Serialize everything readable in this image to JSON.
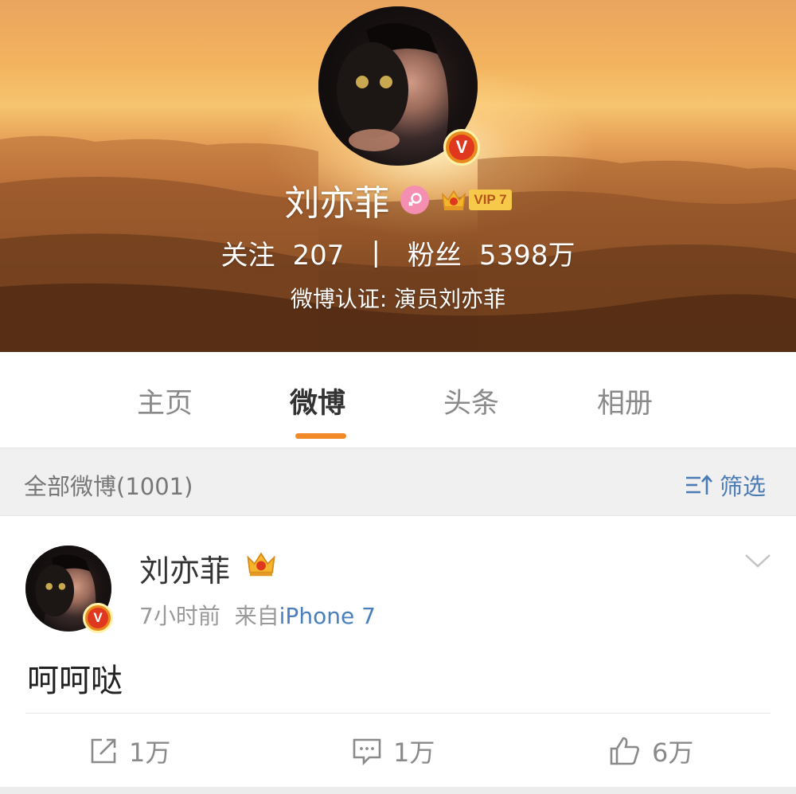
{
  "profile": {
    "name": "刘亦菲",
    "vip_label": "VIP 7",
    "stats": {
      "following_label": "关注",
      "following_value": "207",
      "separator": "|",
      "followers_label": "粉丝",
      "followers_value": "5398万"
    },
    "verification": "微博认证: 演员刘亦菲",
    "verified_badge": "V"
  },
  "tabs": [
    {
      "label": "主页",
      "active": false
    },
    {
      "label": "微博",
      "active": true
    },
    {
      "label": "头条",
      "active": false
    },
    {
      "label": "相册",
      "active": false
    }
  ],
  "filter_bar": {
    "all_label": "全部微博(1001)",
    "filter_label": "筛选"
  },
  "post": {
    "author": "刘亦菲",
    "time": "7小时前",
    "source_prefix": "来自",
    "source": "iPhone 7",
    "text": "呵呵哒",
    "verified_badge": "V",
    "actions": {
      "repost": "1万",
      "comment": "1万",
      "like": "6万"
    }
  },
  "colors": {
    "accent": "#f28a2a",
    "link": "#4a7fbe",
    "verified": "#e0371f"
  },
  "icons": [
    "female-icon",
    "crown-icon",
    "chevron-down-icon",
    "filter-icon",
    "repost-icon",
    "comment-icon",
    "like-icon"
  ]
}
